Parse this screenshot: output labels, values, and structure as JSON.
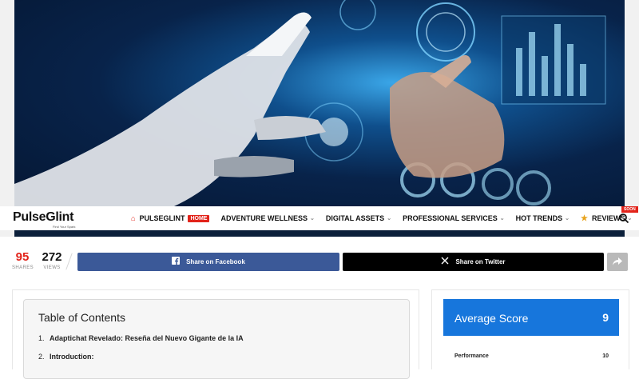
{
  "header": {
    "logo_text": "PulseGlint",
    "logo_tagline": "Find Your Spark",
    "nav": [
      {
        "label": "PULSEGLINT",
        "badge": "HOME"
      },
      {
        "label": "ADVENTURE WELLNESS"
      },
      {
        "label": "DIGITAL ASSETS"
      },
      {
        "label": "PROFESSIONAL SERVICES"
      },
      {
        "label": "HOT TRENDS"
      },
      {
        "label": "REVIEWS",
        "badge": "SOON"
      }
    ]
  },
  "stats": {
    "shares_count": "95",
    "shares_label": "SHARES",
    "views_count": "272",
    "views_label": "VIEWS"
  },
  "share": {
    "facebook_label": "Share on Facebook",
    "twitter_label": "Share on Twitter"
  },
  "toc": {
    "title": "Table of Contents",
    "items": [
      {
        "num": "1.",
        "text": "Adaptichat Revelado: Reseña del Nuevo Gigante de la IA"
      },
      {
        "num": "2.",
        "text": "Introduction:"
      }
    ]
  },
  "score": {
    "title": "Average Score",
    "value": "9",
    "rows": [
      {
        "label": "Performance",
        "value": "10"
      }
    ]
  },
  "colors": {
    "accent_red": "#e2231a",
    "facebook": "#3b5998",
    "twitter": "#000000",
    "score_blue": "#1776dc"
  }
}
